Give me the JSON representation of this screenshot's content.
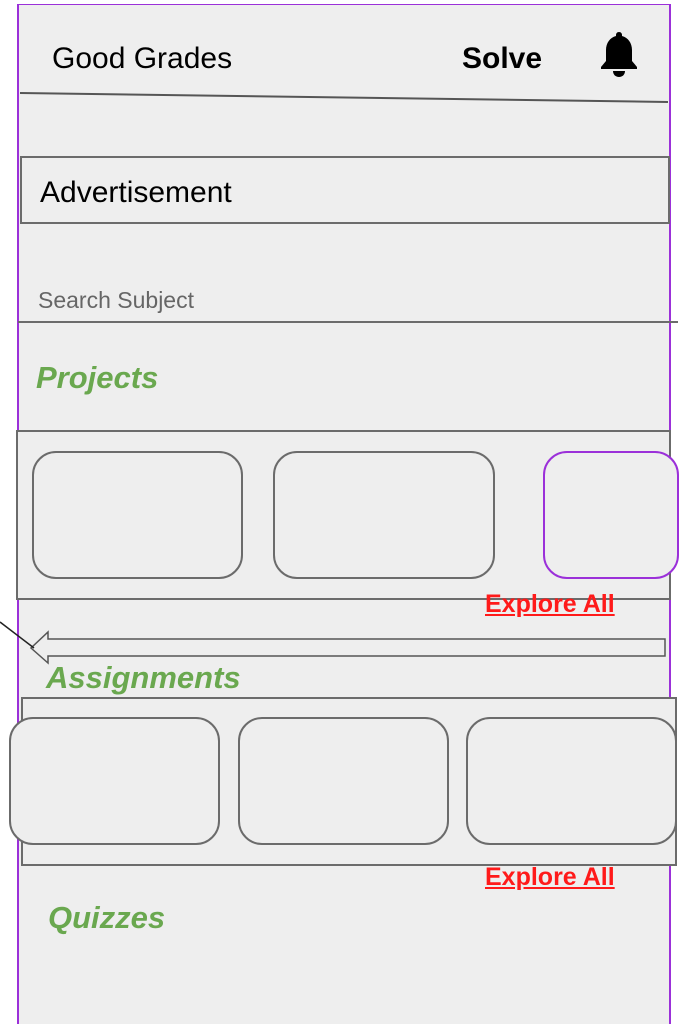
{
  "header": {
    "app_title": "Good Grades",
    "solve_label": "Solve",
    "notifications_icon": "bell-icon"
  },
  "advertisement": {
    "label": "Advertisement"
  },
  "search": {
    "placeholder": "Search Subject",
    "value": ""
  },
  "sections": {
    "projects": {
      "title": "Projects",
      "explore_label": "Explore All",
      "card_count": 3
    },
    "assignments": {
      "title": "Assignments",
      "explore_label": "Explore All",
      "card_count": 3
    },
    "quizzes": {
      "title": "Quizzes"
    }
  },
  "colors": {
    "accent_green": "#6aa84f",
    "link_red": "#ff1a1a",
    "frame_purple": "#9b30d9",
    "background": "#eeeeee",
    "border_gray": "#6b6b6b"
  }
}
